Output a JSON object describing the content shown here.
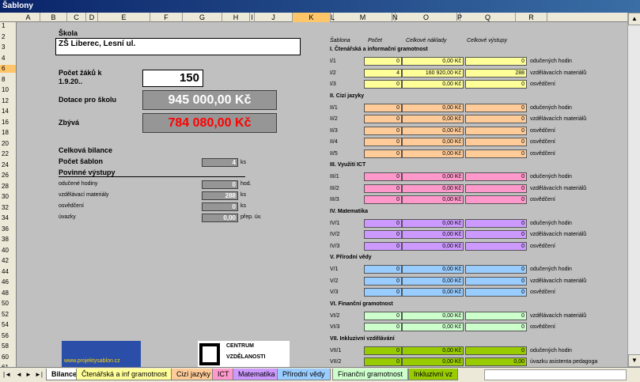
{
  "window": {
    "title": "Šablony"
  },
  "columns": [
    "A",
    "B",
    "C",
    "D",
    "E",
    "F",
    "G",
    "H",
    "I",
    "J",
    "K",
    "L",
    "M",
    "N",
    "O",
    "P",
    "Q",
    "R"
  ],
  "rows": [
    "1",
    "2",
    "3",
    "4",
    "6",
    "8",
    "10",
    "12",
    "14",
    "16",
    "18",
    "20",
    "22",
    "24",
    "26",
    "28",
    "30",
    "32",
    "34",
    "36",
    "38",
    "40",
    "42",
    "44",
    "46",
    "48",
    "50",
    "52",
    "54",
    "56",
    "58",
    "60",
    "61"
  ],
  "left": {
    "skola_label": "Škola",
    "skola_value": "ZŠ Liberec, Lesní ul.",
    "pocet_label1": "Počet žáků k",
    "pocet_label2": "1.9.20..",
    "pocet_value": "150",
    "dotace_label": "Dotace pro školu",
    "dotace_value": "945 000,00 Kč",
    "zbyva_label": "Zbývá",
    "zbyva_value": "784 080,00 Kč",
    "bilance_label": "Celková bilance",
    "pocet_sablon_label": "Počet šablon",
    "pocet_sablon_value": "4",
    "pocet_sablon_unit": "ks",
    "povinne_label": "Povinné výstupy",
    "outputs": [
      {
        "label": "odučené hodiny",
        "value": "0",
        "unit": "hod."
      },
      {
        "label": "vzdělávací materiály",
        "value": "288",
        "unit": "ks"
      },
      {
        "label": "osvědčení",
        "value": "0",
        "unit": "ks"
      },
      {
        "label": "úvazky",
        "value": "0,00",
        "unit": "přep. úv."
      }
    ],
    "logo_text": "www.projektysablon.cz",
    "centrum_line1": "CENTRUM",
    "centrum_line2": "VZDĚLANOSTI"
  },
  "right": {
    "headers": {
      "sablona": "Šablona",
      "pocet": "Počet",
      "naklady": "Celkové náklady",
      "vystupy": "Celkové výstupy"
    },
    "sections": [
      {
        "title": "I. Čtenářská a informační gramotnost",
        "color": "#ffff99",
        "rows": [
          {
            "code": "I/1",
            "count": "0",
            "cost": "0,00 Kč",
            "out": "0",
            "desc": "odučených hodin"
          },
          {
            "code": "I/2",
            "count": "4",
            "cost": "160 920,00 Kč",
            "out": "288",
            "desc": "vzdělávacích materiálů"
          },
          {
            "code": "I/3",
            "count": "0",
            "cost": "0,00 Kč",
            "out": "0",
            "desc": "osvědčení"
          }
        ]
      },
      {
        "title": "II. Cizí jazyky",
        "color": "#ffcc99",
        "rows": [
          {
            "code": "II/1",
            "count": "0",
            "cost": "0,00 Kč",
            "out": "0",
            "desc": "odučených hodin"
          },
          {
            "code": "II/2",
            "count": "0",
            "cost": "0,00 Kč",
            "out": "0",
            "desc": "vzdělávacích materiálů"
          },
          {
            "code": "II/3",
            "count": "0",
            "cost": "0,00 Kč",
            "out": "0",
            "desc": "osvědčení"
          },
          {
            "code": "II/4",
            "count": "0",
            "cost": "0,00 Kč",
            "out": "0",
            "desc": "osvědčení"
          },
          {
            "code": "II/5",
            "count": "0",
            "cost": "0,00 Kč",
            "out": "0",
            "desc": "osvědčení"
          }
        ]
      },
      {
        "title": "III. Využití ICT",
        "color": "#ff99cc",
        "rows": [
          {
            "code": "III/1",
            "count": "0",
            "cost": "0,00 Kč",
            "out": "0",
            "desc": "odučených hodin"
          },
          {
            "code": "III/2",
            "count": "0",
            "cost": "0,00 Kč",
            "out": "0",
            "desc": "vzdělávacích materiálů"
          },
          {
            "code": "III/3",
            "count": "0",
            "cost": "0,00 Kč",
            "out": "0",
            "desc": "osvědčení"
          }
        ]
      },
      {
        "title": "IV. Matematika",
        "color": "#cc99ff",
        "rows": [
          {
            "code": "IV/1",
            "count": "0",
            "cost": "0,00 Kč",
            "out": "0",
            "desc": "odučených hodin"
          },
          {
            "code": "IV/2",
            "count": "0",
            "cost": "0,00 Kč",
            "out": "0",
            "desc": "vzdělávacích materiálů"
          },
          {
            "code": "IV/3",
            "count": "0",
            "cost": "0,00 Kč",
            "out": "0",
            "desc": "osvědčení"
          }
        ]
      },
      {
        "title": "V. Přírodní vědy",
        "color": "#99ccff",
        "rows": [
          {
            "code": "V/1",
            "count": "0",
            "cost": "0,00 Kč",
            "out": "0",
            "desc": "odučených hodin"
          },
          {
            "code": "V/2",
            "count": "0",
            "cost": "0,00 Kč",
            "out": "0",
            "desc": "vzdělávacích materiálů"
          },
          {
            "code": "V/3",
            "count": "0",
            "cost": "0,00 Kč",
            "out": "0",
            "desc": "osvědčení"
          }
        ]
      },
      {
        "title": "VI. Finanční gramotnost",
        "color": "#ccffcc",
        "rows": [
          {
            "code": "VI/2",
            "count": "0",
            "cost": "0,00 Kč",
            "out": "0",
            "desc": "vzdělávacích materiálů"
          },
          {
            "code": "VI/3",
            "count": "0",
            "cost": "0,00 Kč",
            "out": "0",
            "desc": "osvědčení"
          }
        ]
      },
      {
        "title": "VII. Inkluzivní vzdělávání",
        "color": "#99cc00",
        "rows": [
          {
            "code": "VII/1",
            "count": "0",
            "cost": "0,00 Kč",
            "out": "0",
            "desc": "odučených hodin"
          },
          {
            "code": "VII/2",
            "count": "0",
            "cost": "0,00 Kč",
            "out": "0,00",
            "desc": "úvazku asistenta pedagoga"
          },
          {
            "code": "VII/3",
            "count": "0",
            "cost": "0,00 Kč",
            "out": "0,00",
            "desc": "úvazku spec.ped./škol.psych."
          }
        ]
      }
    ]
  },
  "tabs": [
    {
      "label": "Bilance",
      "color": "#ffffff",
      "active": true
    },
    {
      "label": "Čtenářská a inf gramotnost",
      "color": "#ffff99"
    },
    {
      "label": "Cizí jazyky",
      "color": "#ffcc99"
    },
    {
      "label": "ICT",
      "color": "#ff99cc"
    },
    {
      "label": "Matematika",
      "color": "#cc99ff"
    },
    {
      "label": "Přírodní vědy",
      "color": "#99ccff"
    },
    {
      "label": "Finanční gramotnost",
      "color": "#ccffcc"
    },
    {
      "label": "Inkluzivní vz",
      "color": "#99cc00"
    }
  ]
}
